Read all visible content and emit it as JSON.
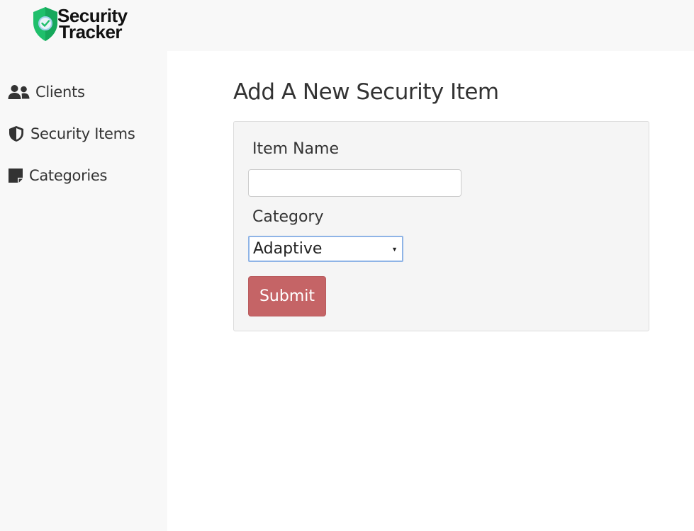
{
  "brand": {
    "name_line1": "Security",
    "name_line2": "Tracker",
    "icon": "shield-check-logo",
    "accent": "#1fbf6b"
  },
  "sidebar": {
    "items": [
      {
        "label": "Clients",
        "icon": "users-icon"
      },
      {
        "label": "Security Items",
        "icon": "shield-icon"
      },
      {
        "label": "Categories",
        "icon": "sticky-note-icon"
      }
    ]
  },
  "main": {
    "title": "Add A New Security Item",
    "form": {
      "item_name_label": "Item Name",
      "item_name_value": "",
      "item_name_placeholder": "",
      "category_label": "Category",
      "category_selected": "Adaptive",
      "submit_label": "Submit",
      "submit_color": "#c56466"
    }
  }
}
